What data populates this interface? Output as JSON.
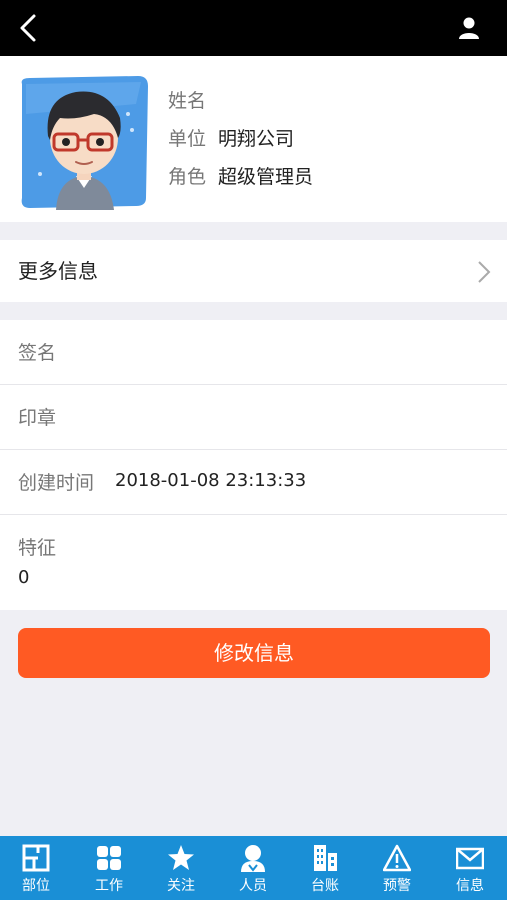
{
  "header": {
    "back_icon": "chevron-left-icon",
    "user_icon": "person-icon"
  },
  "profile": {
    "name_label": "姓名",
    "name_value": "",
    "unit_label": "单位",
    "unit_value": "明翔公司",
    "role_label": "角色",
    "role_value": "超级管理员"
  },
  "more_info": {
    "label": "更多信息"
  },
  "details": {
    "signature_label": "签名",
    "stamp_label": "印章",
    "created_label": "创建时间",
    "created_value": "2018-01-08 23:13:33",
    "feature_label": "特征",
    "feature_value": "0"
  },
  "actions": {
    "edit_label": "修改信息"
  },
  "tabbar": {
    "color": "#1a8fd6",
    "items": [
      {
        "label": "部位",
        "icon": "floorplan-icon"
      },
      {
        "label": "工作",
        "icon": "grid-icon"
      },
      {
        "label": "关注",
        "icon": "star-icon"
      },
      {
        "label": "人员",
        "icon": "person-icon"
      },
      {
        "label": "台账",
        "icon": "building-icon"
      },
      {
        "label": "预警",
        "icon": "warning-icon"
      },
      {
        "label": "信息",
        "icon": "mail-icon"
      }
    ]
  }
}
